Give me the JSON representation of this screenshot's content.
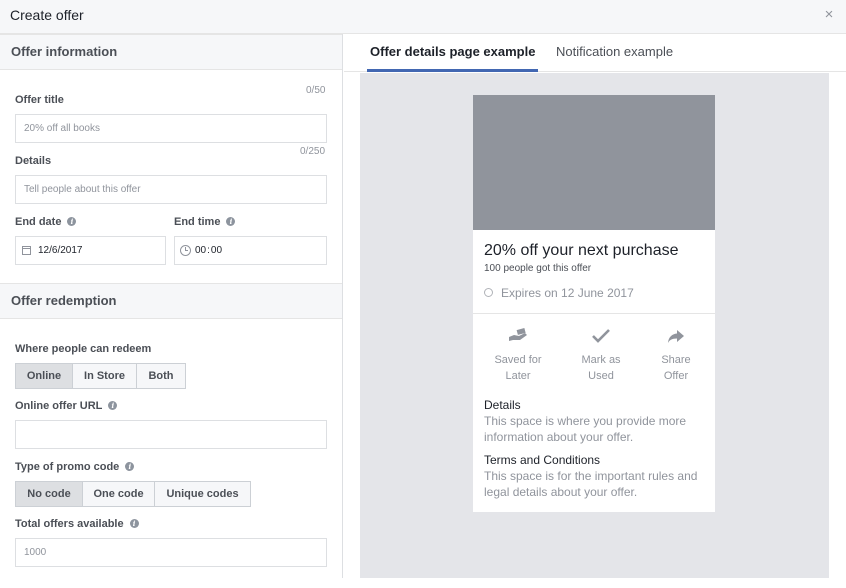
{
  "dialog": {
    "title": "Create offer",
    "close_icon": "×"
  },
  "offer_information": {
    "header": "Offer information",
    "offer_title": {
      "label": "Offer title",
      "counter": "0/50",
      "placeholder": "20% off all books"
    },
    "details": {
      "label": "Details",
      "counter": "0/250",
      "placeholder": "Tell people about this offer"
    },
    "end_date": {
      "label": "End date",
      "value": "12/6/2017"
    },
    "end_time": {
      "label": "End time",
      "hour": "00",
      "minute": "00"
    }
  },
  "offer_redemption": {
    "header": "Offer redemption",
    "where_label": "Where people can redeem",
    "where_options": [
      "Online",
      "In Store",
      "Both"
    ],
    "where_selected": "Online",
    "url_label": "Online offer URL",
    "url_value": "",
    "promo_label": "Type of promo code",
    "promo_options": [
      "No code",
      "One code",
      "Unique codes"
    ],
    "promo_selected": "No code",
    "total_label": "Total offers available",
    "total_placeholder": "1000"
  },
  "preview": {
    "tabs": [
      "Offer details page example",
      "Notification example"
    ],
    "active_tab": "Offer details page example",
    "card": {
      "title": "20% off your next purchase",
      "subtitle": "100 people got this offer",
      "expiry": "Expires on 12 June 2017",
      "actions": [
        {
          "line1": "Saved for",
          "line2": "Later",
          "icon": "hand-offer-icon"
        },
        {
          "line1": "Mark as",
          "line2": "Used",
          "icon": "checkmark-icon"
        },
        {
          "line1": "Share",
          "line2": "Offer",
          "icon": "share-arrow-icon"
        }
      ],
      "details_title": "Details",
      "details_text": "This space is where you provide more information about your offer.",
      "terms_title": "Terms and Conditions",
      "terms_text": "This space is for the important rules and legal details about your offer."
    }
  },
  "colors": {
    "accent": "#4267b2",
    "image_placeholder": "#90949c",
    "preview_bg": "#e4e5e9"
  }
}
